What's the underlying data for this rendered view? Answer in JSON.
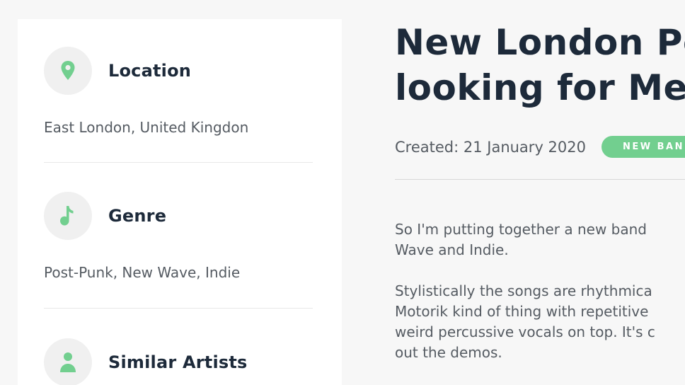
{
  "sidebar": {
    "location": {
      "title": "Location",
      "value": "East London, United Kingdon",
      "icon": "location-pin-icon"
    },
    "genre": {
      "title": "Genre",
      "value": "Post-Punk, New Wave, Indie",
      "icon": "music-note-icon"
    },
    "similar_artists": {
      "title": "Similar Artists",
      "icon": "person-icon"
    }
  },
  "main": {
    "title_line1": "New London Po",
    "title_line2": "looking for Mer",
    "created": "Created: 21 January 2020",
    "badge": "NEW BAN",
    "paragraphs": [
      [
        "So I'm putting together a new band",
        "Wave and Indie."
      ],
      [
        "Stylistically the songs are rhythmica",
        "Motorik kind of thing with repetitive",
        "weird percussive vocals on top. It's c",
        "out the demos."
      ]
    ]
  },
  "colors": {
    "accent": "#72cf8f",
    "heading": "#1d2a3a",
    "text": "#555b62",
    "icon_bg": "#f0f0f0"
  }
}
